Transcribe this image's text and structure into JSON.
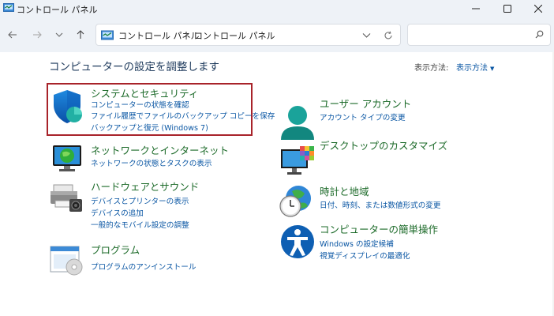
{
  "window": {
    "title": "コントロール パネル"
  },
  "address": {
    "crumbs": [
      "コントロール パネル",
      "コントロール パネル"
    ],
    "search_placeholder": ""
  },
  "main": {
    "heading": "コンピューターの設定を調整します",
    "view_by_label": "表示方法:",
    "view_by_value": "表示方法"
  },
  "categories": {
    "system_security": {
      "title": "システムとセキュリティ",
      "links": [
        "コンピューターの状態を確認",
        "ファイル履歴でファイルのバックアップ コピーを保存",
        "バックアップと復元 (Windows 7)"
      ]
    },
    "network": {
      "title": "ネットワークとインターネット",
      "links": [
        "ネットワークの状態とタスクの表示"
      ]
    },
    "hardware": {
      "title": "ハードウェアとサウンド",
      "links": [
        "デバイスとプリンターの表示",
        "デバイスの追加",
        "一般的なモバイル設定の調整"
      ]
    },
    "programs": {
      "title": "プログラム",
      "links": [
        "プログラムのアンインストール"
      ]
    },
    "user_accounts": {
      "title": "ユーザー アカウント",
      "links": [
        "アカウント タイプの変更"
      ]
    },
    "appearance": {
      "title": "デスクトップのカスタマイズ",
      "links": []
    },
    "clock_region": {
      "title": "時計と地域",
      "links": [
        "日付、時刻、または数値形式の変更"
      ]
    },
    "ease_of_access": {
      "title": "コンピューターの簡単操作",
      "links": [
        "Windows の設定候補",
        "視覚ディスプレイの最適化"
      ]
    }
  },
  "colors": {
    "category_title": "#1d6b2a",
    "link": "#0b57a4",
    "highlight_border": "#a8232a",
    "chrome": "#eef2f7"
  }
}
